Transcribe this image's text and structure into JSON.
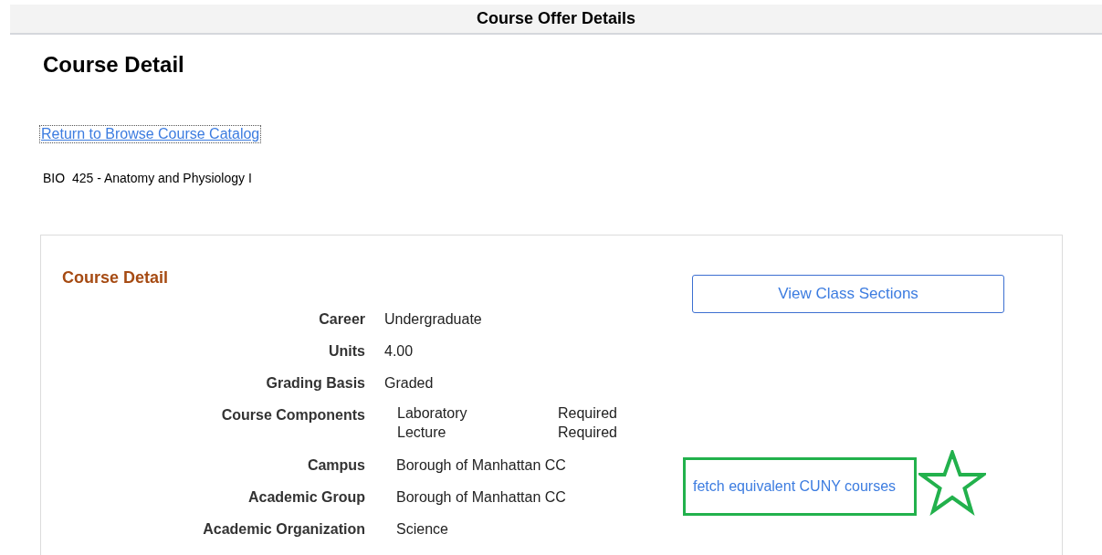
{
  "header": {
    "title": "Course Offer Details"
  },
  "page_title": "Course Detail",
  "return_link": "Return to Browse Course Catalog",
  "course_title": "BIO  425 - Anatomy and Physiology I",
  "detail_panel": {
    "title": "Course Detail",
    "button": "View Class Sections",
    "fields": [
      {
        "kind": "value",
        "label": "Career",
        "value": "Undergraduate"
      },
      {
        "kind": "value",
        "label": "Units",
        "value": "4.00"
      },
      {
        "kind": "value",
        "label": "Grading Basis",
        "value": "Graded"
      },
      {
        "kind": "components",
        "label": "Course Components",
        "components": [
          {
            "name": "Laboratory",
            "status": "Required"
          },
          {
            "name": "Lecture",
            "status": "Required"
          }
        ]
      },
      {
        "kind": "detail",
        "label": "Campus",
        "value": "Borough of Manhattan CC"
      },
      {
        "kind": "detail",
        "label": "Academic Group",
        "value": "Borough of Manhattan CC"
      },
      {
        "kind": "detail",
        "label": "Academic Organization",
        "value": "Science"
      }
    ],
    "annotated_link": "fetch equivalent CUNY courses"
  }
}
